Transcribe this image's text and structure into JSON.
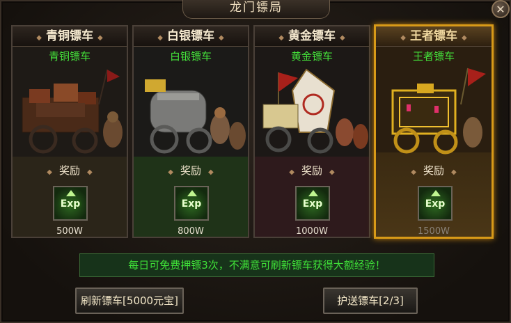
{
  "title": "龙门镖局",
  "close_icon": "close-icon",
  "cards": [
    {
      "name": "青铜镖车",
      "subtitle": "青铜镖车",
      "reward_label": "奖励",
      "reward_icon": "exp-icon",
      "reward_icon_text": "Exp",
      "reward_value": "500W",
      "selected": false,
      "header_color": "#f6ead0"
    },
    {
      "name": "白银镖车",
      "subtitle": "白银镖车",
      "reward_label": "奖励",
      "reward_icon": "exp-icon",
      "reward_icon_text": "Exp",
      "reward_value": "800W",
      "selected": false,
      "header_color": "#f6ead0"
    },
    {
      "name": "黄金镖车",
      "subtitle": "黄金镖车",
      "reward_label": "奖励",
      "reward_icon": "exp-icon",
      "reward_icon_text": "Exp",
      "reward_value": "1000W",
      "selected": false,
      "header_color": "#f6ead0"
    },
    {
      "name": "王者镖车",
      "subtitle": "王者镖车",
      "reward_label": "奖励",
      "reward_icon": "exp-icon",
      "reward_icon_text": "Exp",
      "reward_value": "1500W",
      "selected": true,
      "header_color": "#f6ead0"
    }
  ],
  "notice": "每日可免费押镖3次，不满意可刷新镖车获得大额经验！",
  "buttons": {
    "refresh": "刷新镖车[5000元宝]",
    "escort": "护送镖车[2/3]"
  },
  "colors": {
    "accent_gold": "#d89a18",
    "notice_green": "#3fe038",
    "subtitle_green": "#44e23a"
  }
}
